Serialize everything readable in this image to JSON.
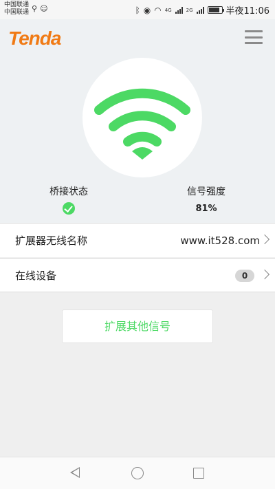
{
  "status_bar": {
    "carrier_1": "中国联通",
    "carrier_2": "中国联通",
    "network_1": "4G",
    "network_2": "2G",
    "time": "半夜11:06",
    "battery_level": 0.85
  },
  "header": {
    "logo": "Tenda"
  },
  "status": {
    "bridge_label": "桥接状态",
    "signal_label": "信号强度",
    "signal_value": "81%"
  },
  "rows": {
    "ssid_label": "扩展器无线名称",
    "ssid_value": "www.it528.com",
    "devices_label": "在线设备",
    "devices_count": "0"
  },
  "actions": {
    "extend_label": "扩展其他信号"
  },
  "colors": {
    "brand": "#f07a14",
    "accent": "#4cd964"
  }
}
